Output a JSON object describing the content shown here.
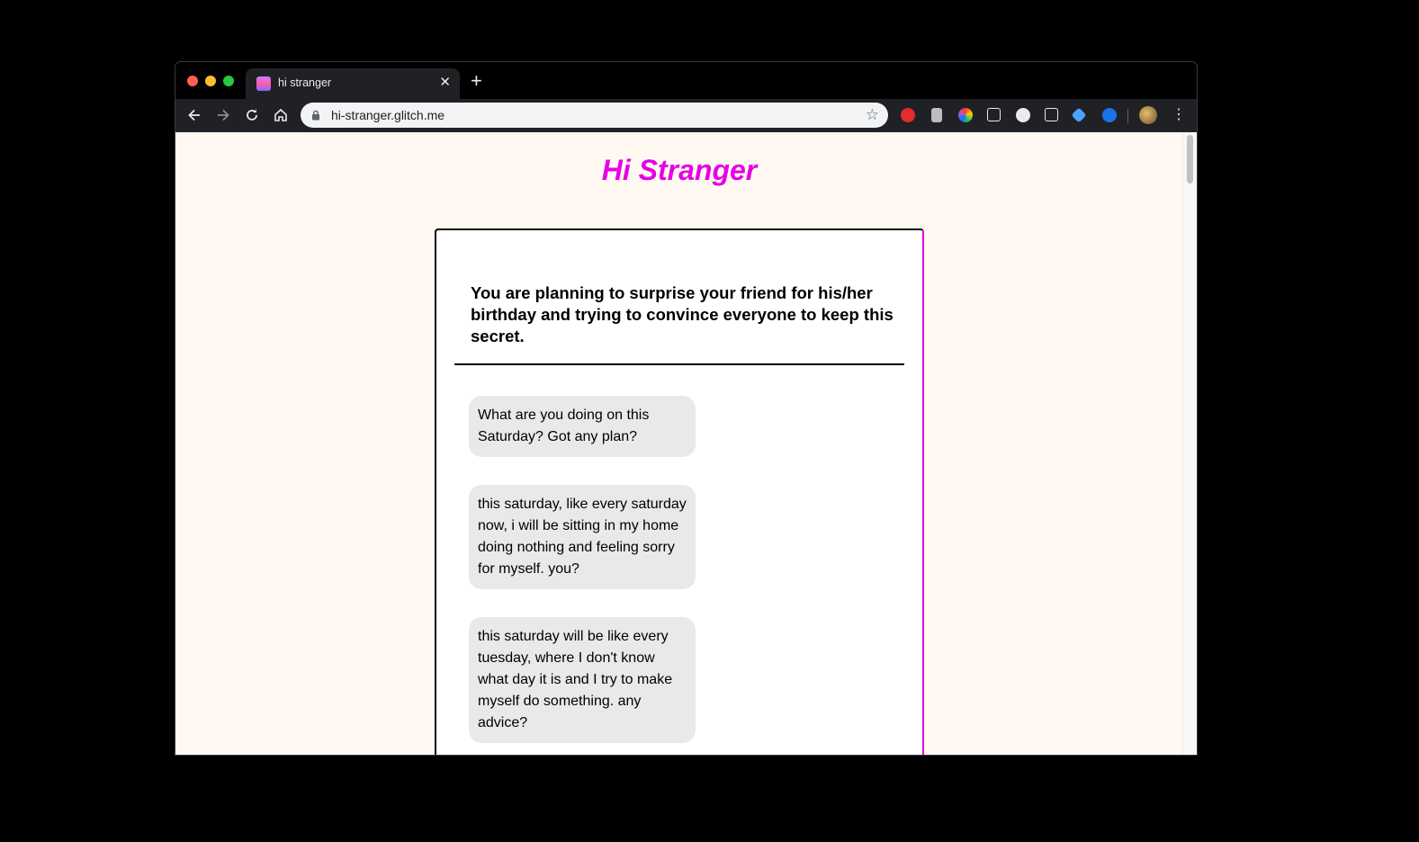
{
  "browser": {
    "tab_title": "hi stranger",
    "url": "hi-stranger.glitch.me",
    "tab_close": "✕",
    "new_tab": "+",
    "star": "☆",
    "menu": "⋮",
    "extensions": [
      "red-hand-icon",
      "document-icon",
      "color-wheel-icon",
      "notion-icon",
      "1password-icon",
      "cb-icon",
      "diamond-icon",
      "museum-icon"
    ]
  },
  "page": {
    "title": "Hi Stranger",
    "prompt": "You are planning to surprise your friend for his/her birthday and trying to convince everyone to keep this secret.",
    "messages": [
      "What are you doing on this Saturday? Got any plan?",
      "this saturday, like every saturday now, i will be sitting in my home doing nothing and feeling sorry for myself. you?",
      "this saturday will be like every tuesday, where I don't know what day it is and I try to make myself do something. any advice?"
    ]
  },
  "colors": {
    "title": "#e600e6",
    "page_background": "#fff9f2",
    "bubble_background": "#e9e9e9",
    "chrome_dark": "#202124"
  }
}
